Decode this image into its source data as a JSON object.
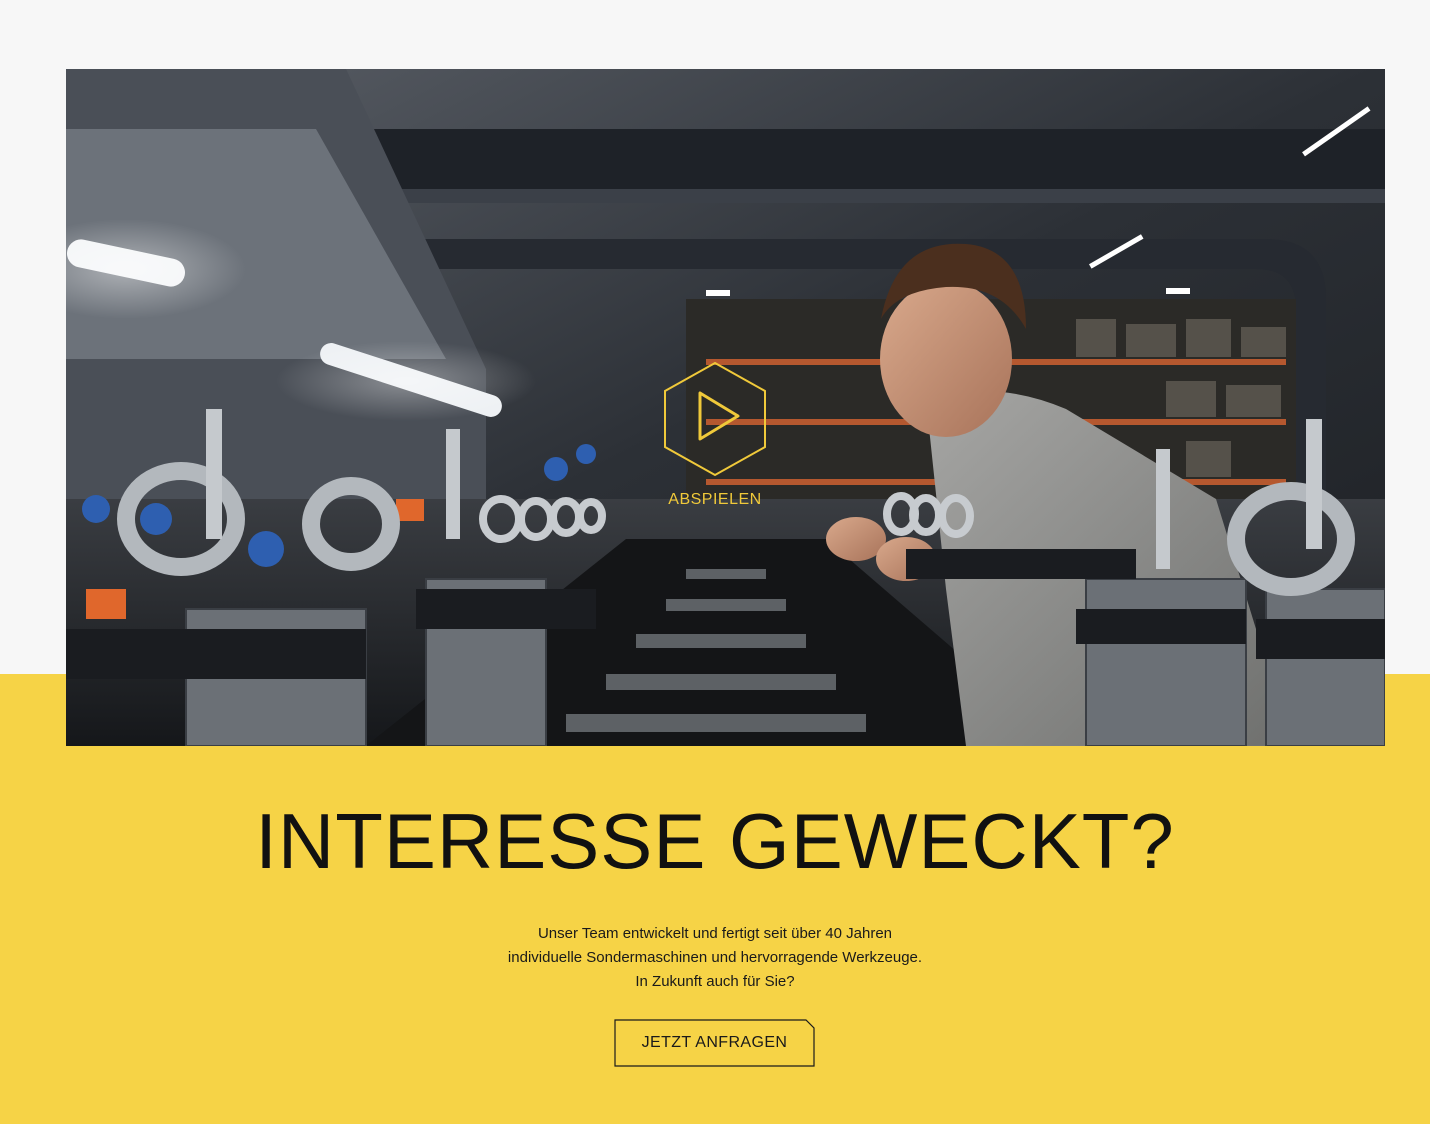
{
  "colors": {
    "accent_yellow": "#f6d346",
    "play_icon_yellow": "#f0c93a",
    "text_dark": "#111111",
    "page_background": "#f7f7f7"
  },
  "video": {
    "play_label": "ABSPIELEN",
    "play_icon": "hexagon-play-icon"
  },
  "cta_section": {
    "headline": "INTERESSE GEWECKT?",
    "intro_lines": [
      "Unser Team entwickelt und fertigt seit über 40 Jahren",
      "individuelle Sondermaschinen und hervorragende Werkzeuge.",
      "In Zukunft auch für Sie?"
    ],
    "button_label": "JETZT ANFRAGEN"
  }
}
